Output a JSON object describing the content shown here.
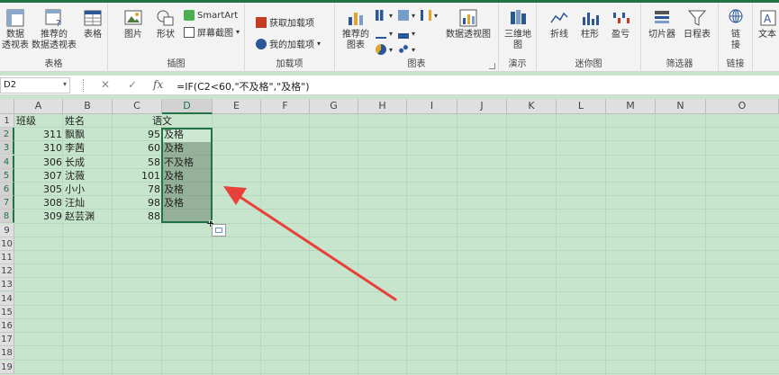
{
  "ribbon": {
    "groups": {
      "tables": "表格",
      "illustrations": "插图",
      "addins": "加载项",
      "charts": "图表",
      "tours": "演示",
      "sparklines": "迷你图",
      "filters": "筛选器",
      "links": "链接"
    },
    "pivot_line1": "数据",
    "pivot_line2": "透视表",
    "rec_pivot_line1": "推荐的",
    "rec_pivot_line2": "数据透视表",
    "table": "表格",
    "pictures": "图片",
    "shapes": "形状",
    "smartart": "SmartArt",
    "screenshot": "屏幕截图",
    "get_addins": "获取加载项",
    "my_addins": "我的加载项",
    "rec_charts_line1": "推荐的",
    "rec_charts_line2": "图表",
    "pivot_chart": "数据透视图",
    "map3d_line1": "三维地",
    "map3d_line2": "图",
    "line": "折线",
    "column": "柱形",
    "winloss": "盈亏",
    "slicer": "切片器",
    "timeline": "日程表",
    "link_line1": "链",
    "link_line2": "接",
    "text": "文本",
    "accent": "#217346"
  },
  "formula_bar": {
    "name_box": "D2",
    "cancel": "✕",
    "enter": "✓",
    "fx": "fx",
    "formula": "=IF(C2<60,\"不及格\",\"及格\")"
  },
  "grid": {
    "columns": [
      "A",
      "B",
      "C",
      "D",
      "E",
      "F",
      "G",
      "H",
      "I",
      "J",
      "K",
      "L",
      "M",
      "N",
      "O"
    ],
    "rows": [
      "1",
      "2",
      "3",
      "4",
      "5",
      "6",
      "7",
      "8",
      "9",
      "10",
      "11",
      "12",
      "13",
      "14",
      "15",
      "16",
      "17",
      "18",
      "19"
    ],
    "header": [
      "班级",
      "姓名",
      "语文"
    ],
    "data": [
      [
        "311",
        "飘飘",
        "95",
        "及格"
      ],
      [
        "310",
        "李茜",
        "60",
        "及格"
      ],
      [
        "306",
        "长成",
        "58",
        "不及格"
      ],
      [
        "307",
        "沈薇",
        "101",
        "及格"
      ],
      [
        "305",
        "小小",
        "78",
        "及格"
      ],
      [
        "308",
        "汪灿",
        "98",
        "及格"
      ],
      [
        "309",
        "赵芸渊",
        "88",
        ""
      ]
    ]
  },
  "annotation": {
    "arrow_color": "#e8413a"
  }
}
